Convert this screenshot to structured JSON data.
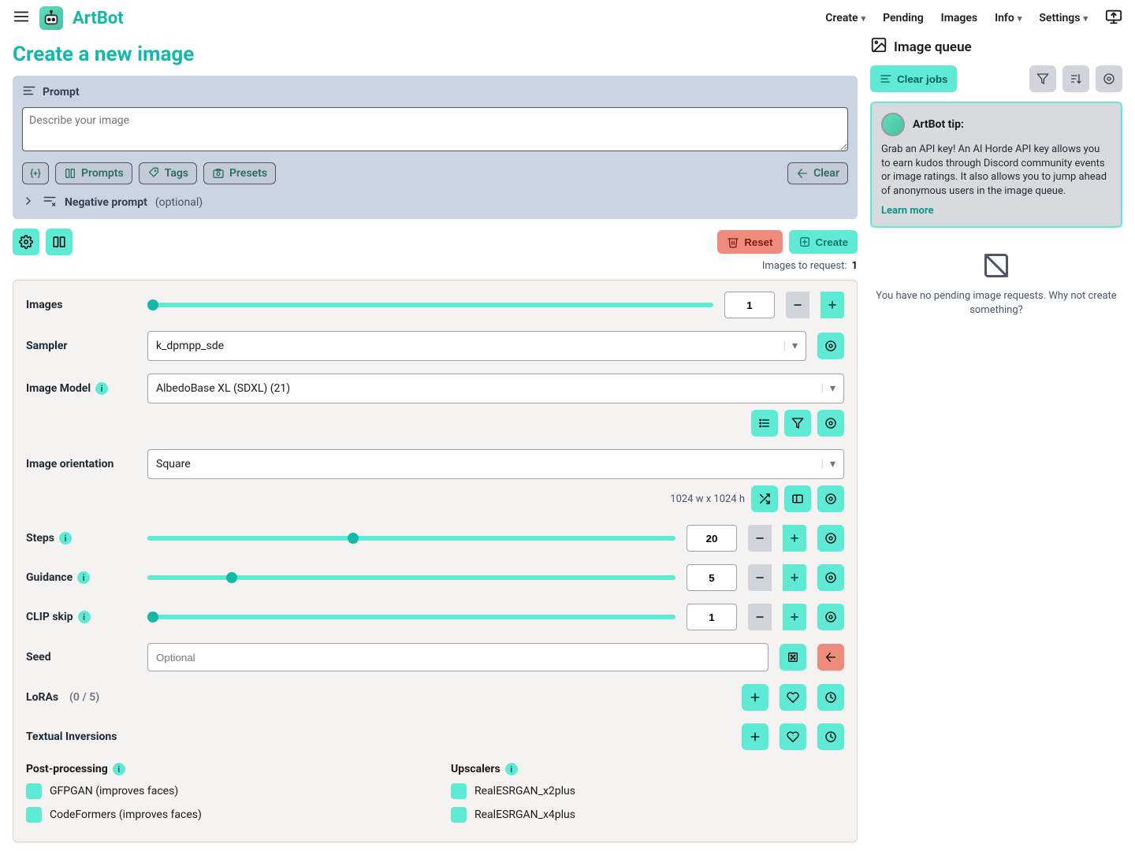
{
  "brand": "ArtBot",
  "nav": {
    "create": "Create",
    "pending": "Pending",
    "images": "Images",
    "info": "Info",
    "settings": "Settings"
  },
  "page_title": "Create a new image",
  "prompt": {
    "label": "Prompt",
    "placeholder": "Describe your image",
    "prompts_btn": "Prompts",
    "tags_btn": "Tags",
    "presets_btn": "Presets",
    "clear_btn": "Clear",
    "neg_label": "Negative prompt",
    "neg_opt": "(optional)"
  },
  "actions": {
    "reset": "Reset",
    "create": "Create",
    "req_label": "Images to request:",
    "req_count": "1"
  },
  "settings": {
    "images": {
      "label": "Images",
      "value": "1",
      "pct": 0
    },
    "sampler": {
      "label": "Sampler",
      "value": "k_dpmpp_sde"
    },
    "model": {
      "label": "Image Model",
      "value": "AlbedoBase XL (SDXL) (21)"
    },
    "orientation": {
      "label": "Image orientation",
      "value": "Square",
      "dims": "1024 w x 1024 h"
    },
    "steps": {
      "label": "Steps",
      "value": "20",
      "pct": 39
    },
    "guidance": {
      "label": "Guidance",
      "value": "5",
      "pct": 16
    },
    "clip": {
      "label": "CLIP skip",
      "value": "1",
      "pct": 0
    },
    "seed": {
      "label": "Seed",
      "placeholder": "Optional"
    },
    "loras": {
      "label": "LoRAs",
      "count": "(0 / 5)"
    },
    "tinv": {
      "label": "Textual Inversions"
    },
    "pp": {
      "title": "Post-processing",
      "gfpgan": "GFPGAN (improves faces)",
      "codeformers": "CodeFormers (improves faces)"
    },
    "up": {
      "title": "Upscalers",
      "x2": "RealESRGAN_x2plus",
      "x4": "RealESRGAN_x4plus"
    }
  },
  "queue": {
    "title": "Image queue",
    "clear": "Clear jobs",
    "tip_title": "ArtBot tip:",
    "tip_body": "Grab an API key! An AI Horde API key allows you to earn kudos through Discord community events or image ratings. It also allows you to jump ahead of anonymous users in the image queue.",
    "tip_link": "Learn more",
    "empty": "You have no pending image requests. Why not create something?"
  }
}
